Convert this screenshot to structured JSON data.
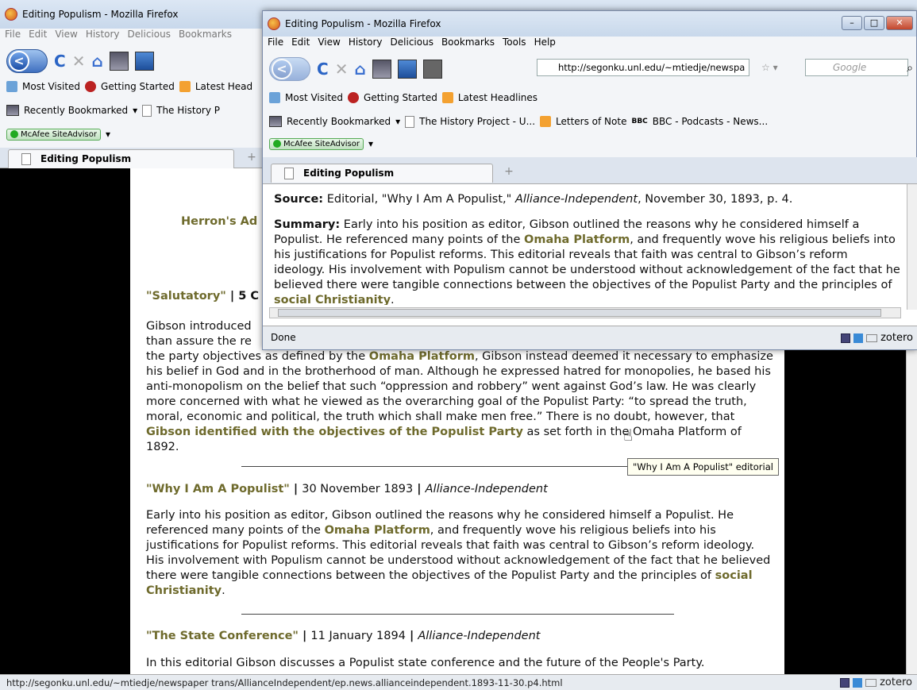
{
  "back_window": {
    "title": "Editing Populism - Mozilla Firefox",
    "menu": [
      "File",
      "Edit",
      "View",
      "History",
      "Delicious",
      "Bookmarks"
    ],
    "bookmarks1": [
      "Most Visited",
      "Getting Started",
      "Latest Head"
    ],
    "bookmarks2": [
      "Recently Bookmarked",
      "The History P"
    ],
    "mcafee": "McAfee SiteAdvisor",
    "tab_label": "Editing Populism",
    "status_url": "http://segonku.unl.edu/~mtiedje/newspaper trans/AllianceIndependent/ep.news.allianceindependent.1893-11-30.p4.html",
    "zotero": "zotero",
    "tooltip": "\"Why I Am A Populist\" editorial"
  },
  "article": {
    "heading_partial": "Herron's Ad",
    "salutatory_title": "\"Salutatory\"",
    "salutatory_meta": " | 5 C",
    "salutatory_p1_line1": "Gibson introduced",
    "salutatory_p1_line2": "than assure the re",
    "salutatory_p1_rest_a": "the party objectives as defined by the ",
    "omaha1": "Omaha Platform",
    "salutatory_p1_rest_b": ", Gibson instead deemed it necessary to emphasize his belief in God and in the brotherhood of man. Although he expressed hatred for monopolies, he based his anti-monopolism on the belief that such “oppression and robbery” went against God’s law. He was clearly more concerned with what he viewed as the overarching goal of the Populist Party: “to spread the truth, moral, economic and political, the truth which shall make men free.” There is no doubt, however, that ",
    "gibson_link": "Gibson identified with the objectives of the Populist Party",
    "salutatory_p1_end": " as set forth in the Omaha Platform of 1892.",
    "why_title": "\"Why I Am A Populist\"",
    "why_date": "30 November 1893",
    "why_paper": "Alliance-Independent",
    "why_p_a": "Early into his position as editor, Gibson outlined the reasons why he considered himself a Populist. He referenced many points of the ",
    "omaha2": "Omaha Platform",
    "why_p_b": ", and frequently wove his religious beliefs into his justifications for Populist reforms. This editorial reveals that faith was central to Gibson’s reform ideology. His involvement with Populism cannot be understood without acknowledgement of the fact that he believed there were tangible connections between the objectives of the Populist Party and the principles of ",
    "social": "social Christianity",
    "why_p_end": ".",
    "state_title": "\"The State Conference\"",
    "state_date": "11 January 1894",
    "state_paper": "Alliance-Independent",
    "state_p": "In this editorial Gibson discusses a Populist state conference and the future of the People's Party.",
    "sep": " | "
  },
  "popup": {
    "title": "Editing Populism - Mozilla Firefox",
    "menu": [
      "File",
      "Edit",
      "View",
      "History",
      "Delicious",
      "Bookmarks",
      "Tools",
      "Help"
    ],
    "url": "http://segonku.unl.edu/~mtiedje/newspa",
    "search_placeholder": "Google",
    "bookmarks1": [
      "Most Visited",
      "Getting Started",
      "Latest Headlines"
    ],
    "bookmarks2": [
      "Recently Bookmarked",
      "The History Project - U...",
      "Letters of Note",
      "BBC - Podcasts - News..."
    ],
    "mcafee": "McAfee SiteAdvisor",
    "tab_label": "Editing Populism",
    "source_label": "Source:",
    "source_text_a": " Editorial, \"Why I Am A Populist,\" ",
    "source_paper": "Alliance-Independent",
    "source_text_b": ", November 30, 1893, p. 4.",
    "summary_label": "Summary:",
    "summary_a": " Early into his position as editor, Gibson outlined the reasons why he considered himself a Populist. He referenced many points of the ",
    "omaha": "Omaha Platform",
    "summary_b": ", and frequently wove his religious beliefs into his justifications for Populist reforms. This editorial reveals that faith was central to Gibson’s reform ideology. His involvement with Populism cannot be understood without acknowledgement of the fact that he believed there were tangible connections between the objectives of the Populist Party and the principles of ",
    "social": "social Christianity",
    "summary_end": ".",
    "status": "Done",
    "zotero": "zotero"
  }
}
